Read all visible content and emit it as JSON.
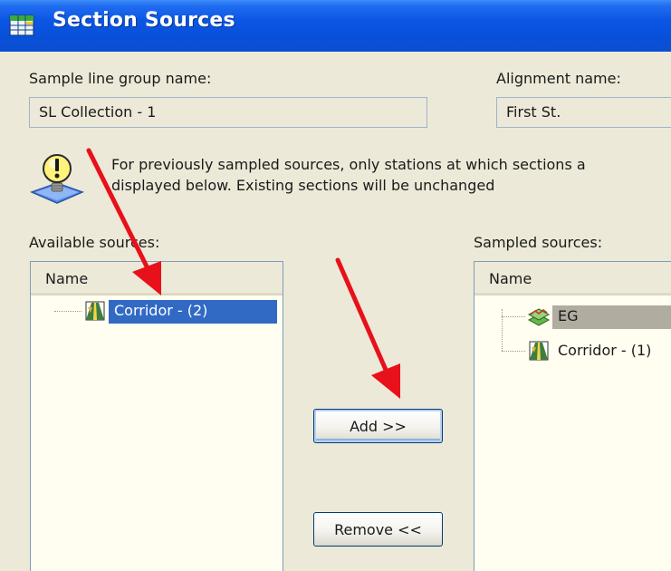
{
  "window": {
    "title": "Section Sources",
    "title_icon": "table-grid-icon"
  },
  "fields": {
    "sample_line_group": {
      "label": "Sample line group name:",
      "value": "SL Collection - 1"
    },
    "alignment": {
      "label": "Alignment name:",
      "value": "First St."
    }
  },
  "info": {
    "icon": "lightbulb-info-icon",
    "line1": "For previously sampled sources, only stations at which sections a",
    "line2": "displayed below. Existing sections will be unchanged"
  },
  "available": {
    "label": "Available sources:",
    "column": "Name",
    "items": [
      {
        "label": "Corridor - (2)",
        "icon": "corridor-icon",
        "selected": true
      }
    ]
  },
  "sampled": {
    "label": "Sampled sources:",
    "column": "Name",
    "items": [
      {
        "label": "EG",
        "icon": "surface-icon",
        "selected": false
      },
      {
        "label": "Corridor - (1)",
        "icon": "corridor-icon",
        "selected": false
      }
    ]
  },
  "buttons": {
    "add": "Add >>",
    "remove": "Remove <<"
  },
  "annotations": {
    "arrow_color": "#e8101a"
  },
  "colors": {
    "titlebar": "#0a56e4",
    "dialog_bg": "#ece9d8",
    "list_bg": "#fffef0",
    "selection": "#316ac5"
  }
}
